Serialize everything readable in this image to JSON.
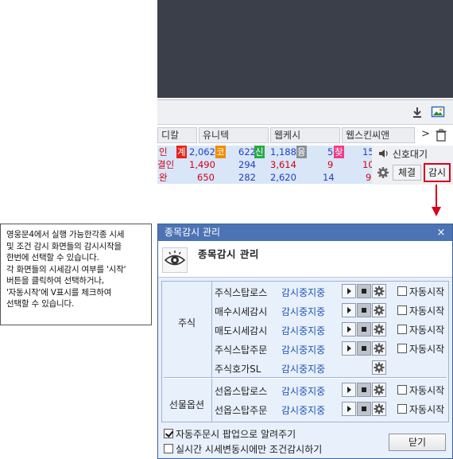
{
  "app": {
    "header_cells": [
      "디칼",
      "유니텍",
      "웹케시",
      "웹스킨씨앤"
    ],
    "chevron": ">",
    "rows": [
      {
        "name": "인",
        "badge": "계",
        "price": "2,062",
        "badge2": "코",
        "v2": "622",
        "badge3": "신",
        "v3": "1,188",
        "badge4": "융",
        "v4": "5",
        "badge5": "찾",
        "v5": "15"
      },
      {
        "name": "결인",
        "price": "1,490",
        "v2": "294",
        "v3": "3,614",
        "v4": "9",
        "v5": "10"
      },
      {
        "name": "완",
        "price": "650",
        "v2": "282",
        "v3": "2,620",
        "v4": "14",
        "v5": "9"
      }
    ],
    "signal_label": "신호대기",
    "fill_label": "체결",
    "monitor_label": "감시"
  },
  "callout": {
    "lines": [
      "영웅문4에서 실행 가능한각종 시세",
      "및 조건 감시 화면들의 감시시작을",
      "한번에 선택할 수 있습니다.",
      "각 화면들의 시세감시 여부를 '시작'",
      "버튼을 클릭하여 선택하거나,",
      "'자동시작'에 V표시를 체크하여",
      "선택할 수 있습니다."
    ]
  },
  "dialog": {
    "title": "종목감시 관리",
    "close_glyph": "×",
    "heading": "종목감시 관리",
    "groups": [
      {
        "label": "주식",
        "rows": [
          {
            "name": "주식스탑로스",
            "status": "감시중지중",
            "auto_label": "자동시작",
            "auto": false,
            "controls": true
          },
          {
            "name": "매수시세감시",
            "status": "감시중지중",
            "auto_label": "자동시작",
            "auto": false,
            "controls": true
          },
          {
            "name": "매도시세감시",
            "status": "감시중지중",
            "auto_label": "자동시작",
            "auto": false,
            "controls": true
          },
          {
            "name": "주식스탑주문",
            "status": "감시중지중",
            "auto_label": "자동시작",
            "auto": false,
            "controls": true
          },
          {
            "name": "주식호가SL",
            "status": "감시중지중",
            "controls": false
          }
        ]
      },
      {
        "label": "선물옵션",
        "rows": [
          {
            "name": "선옵스탑로스",
            "status": "감시중지중",
            "auto_label": "자동시작",
            "auto": false,
            "controls": true
          },
          {
            "name": "선옵스탑주문",
            "status": "감시중지중",
            "auto_label": "자동시작",
            "auto": false,
            "controls": true
          }
        ]
      }
    ],
    "options": [
      {
        "label": "자동주문시 팝업으로 알려주기",
        "checked": true
      },
      {
        "label": "실시간 시세변동시에만 조건감시하기",
        "checked": false
      }
    ],
    "close_button": "닫기"
  },
  "colors": {
    "title_bar": "#4c74b5",
    "highlight": "#d6001c",
    "status_text": "#1f56b8"
  }
}
